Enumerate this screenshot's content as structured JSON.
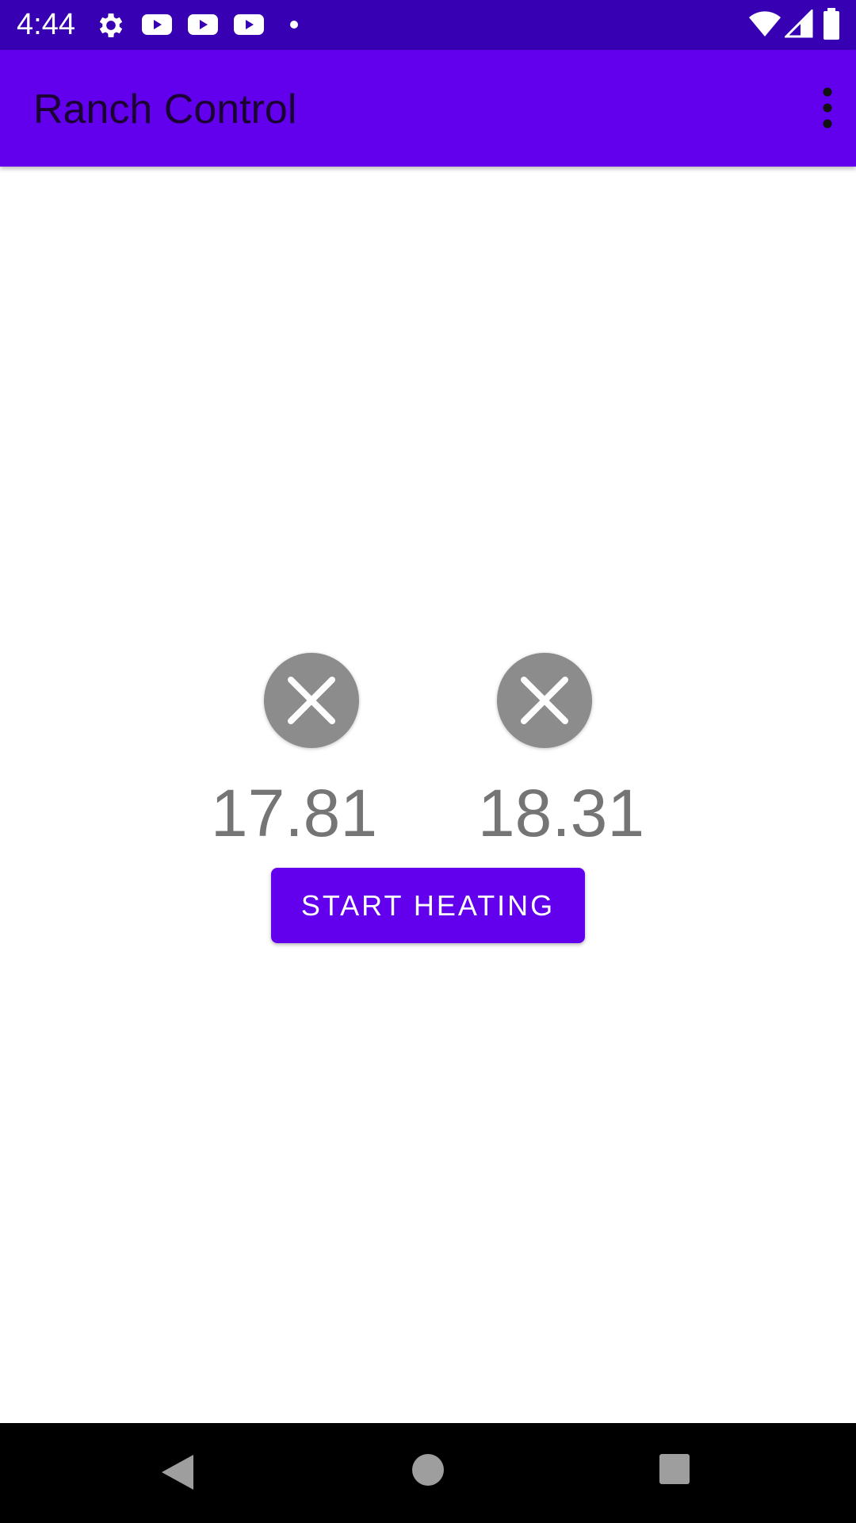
{
  "status_bar": {
    "time": "4:44",
    "icons": [
      "settings-icon",
      "youtube-icon",
      "youtube-icon",
      "youtube-icon",
      "dot-icon",
      "wifi-icon",
      "cell-signal-icon",
      "battery-icon"
    ],
    "background": "#3700b3"
  },
  "app_bar": {
    "title": "Ranch Control",
    "menu_icon": "more-vert-icon",
    "background": "#6200ee"
  },
  "sensors": [
    {
      "status_icon": "close-circle-icon",
      "temperature": "17.81"
    },
    {
      "status_icon": "close-circle-icon",
      "temperature": "18.31"
    }
  ],
  "actions": {
    "start_heating_label": "START HEATING",
    "accent": "#6200ee"
  },
  "nav_bar": {
    "icons": [
      "back-icon",
      "home-icon",
      "recents-icon"
    ]
  }
}
